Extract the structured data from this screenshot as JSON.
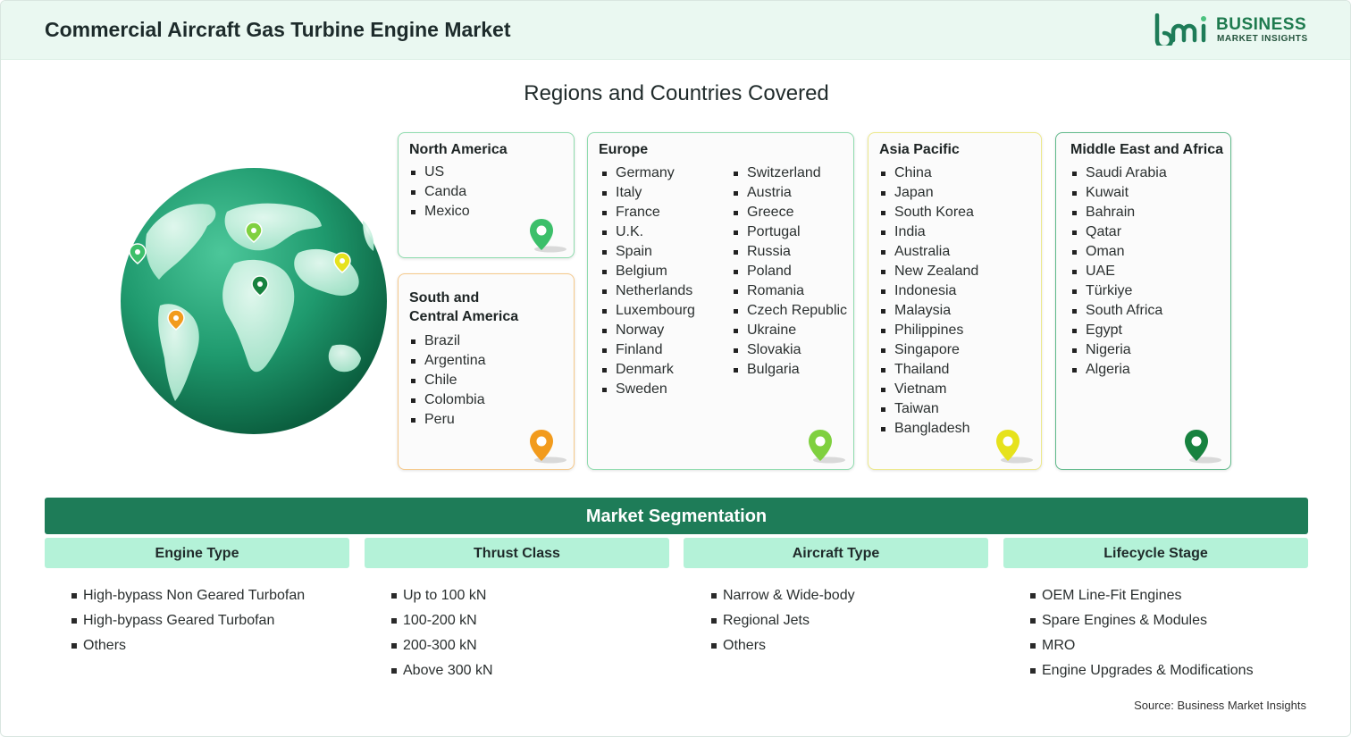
{
  "header": {
    "title": "Commercial Aircraft Gas Turbine Engine Market",
    "logo_line1": "BUSINESS",
    "logo_line2": "MARKET INSIGHTS"
  },
  "regions_title": "Regions and Countries Covered",
  "regions": {
    "north_america": {
      "title": "North America",
      "items": [
        "US",
        "Canda",
        "Mexico"
      ],
      "pin_color": "#3cbf6a"
    },
    "south_central_america": {
      "title_line1": "South and",
      "title_line2": "Central America",
      "items": [
        "Brazil",
        "Argentina",
        "Chile",
        "Colombia",
        "Peru"
      ],
      "pin_color": "#f29b1d"
    },
    "europe": {
      "title": "Europe",
      "col1": [
        "Germany",
        "Italy",
        "France",
        "U.K.",
        "Spain",
        "Belgium",
        "Netherlands",
        "Luxembourg",
        "Norway",
        "Finland",
        "Denmark",
        "Sweden"
      ],
      "col2": [
        "Switzerland",
        "Austria",
        "Greece",
        "Portugal",
        "Russia",
        "Poland",
        "Romania",
        "Czech Republic",
        "Ukraine",
        "Slovakia",
        "Bulgaria"
      ],
      "pin_color": "#7fd03f"
    },
    "asia_pacific": {
      "title": "Asia Pacific",
      "items": [
        "China",
        "Japan",
        "South Korea",
        "India",
        "Australia",
        "New Zealand",
        "Indonesia",
        "Malaysia",
        "Philippines",
        "Singapore",
        "Thailand",
        "Vietnam",
        "Taiwan",
        "Bangladesh"
      ],
      "pin_color": "#e6e21c"
    },
    "mea": {
      "title": "Middle East and Africa",
      "items": [
        "Saudi Arabia",
        "Kuwait",
        "Bahrain",
        "Qatar",
        "Oman",
        "UAE",
        "Türkiye",
        "South Africa",
        "Egypt",
        "Nigeria",
        "Algeria"
      ],
      "pin_color": "#17823f"
    }
  },
  "segmentation": {
    "title": "Market Segmentation",
    "columns": [
      {
        "header": "Engine Type",
        "items": [
          "High-bypass Non Geared Turbofan",
          "High-bypass Geared Turbofan",
          "Others"
        ]
      },
      {
        "header": "Thrust Class",
        "items": [
          "Up to 100 kN",
          "100-200 kN",
          "200-300 kN",
          "Above 300 kN"
        ]
      },
      {
        "header": "Aircraft Type",
        "items": [
          "Narrow & Wide-body",
          "Regional Jets",
          "Others"
        ]
      },
      {
        "header": "Lifecycle Stage",
        "items": [
          "OEM Line-Fit Engines",
          "Spare Engines & Modules",
          "MRO",
          "Engine Upgrades & Modifications"
        ]
      }
    ]
  },
  "source": "Source: Business Market Insights",
  "colors": {
    "header_bg": "#eaf8f1",
    "brand_green": "#1e7c58",
    "segment_header_bg": "#b4f2d8",
    "card_border_green": "#8fdcae",
    "card_border_orange": "#f6c98a",
    "card_border_yellow": "#ede98a",
    "card_border_dark_green": "#5fb98a"
  }
}
